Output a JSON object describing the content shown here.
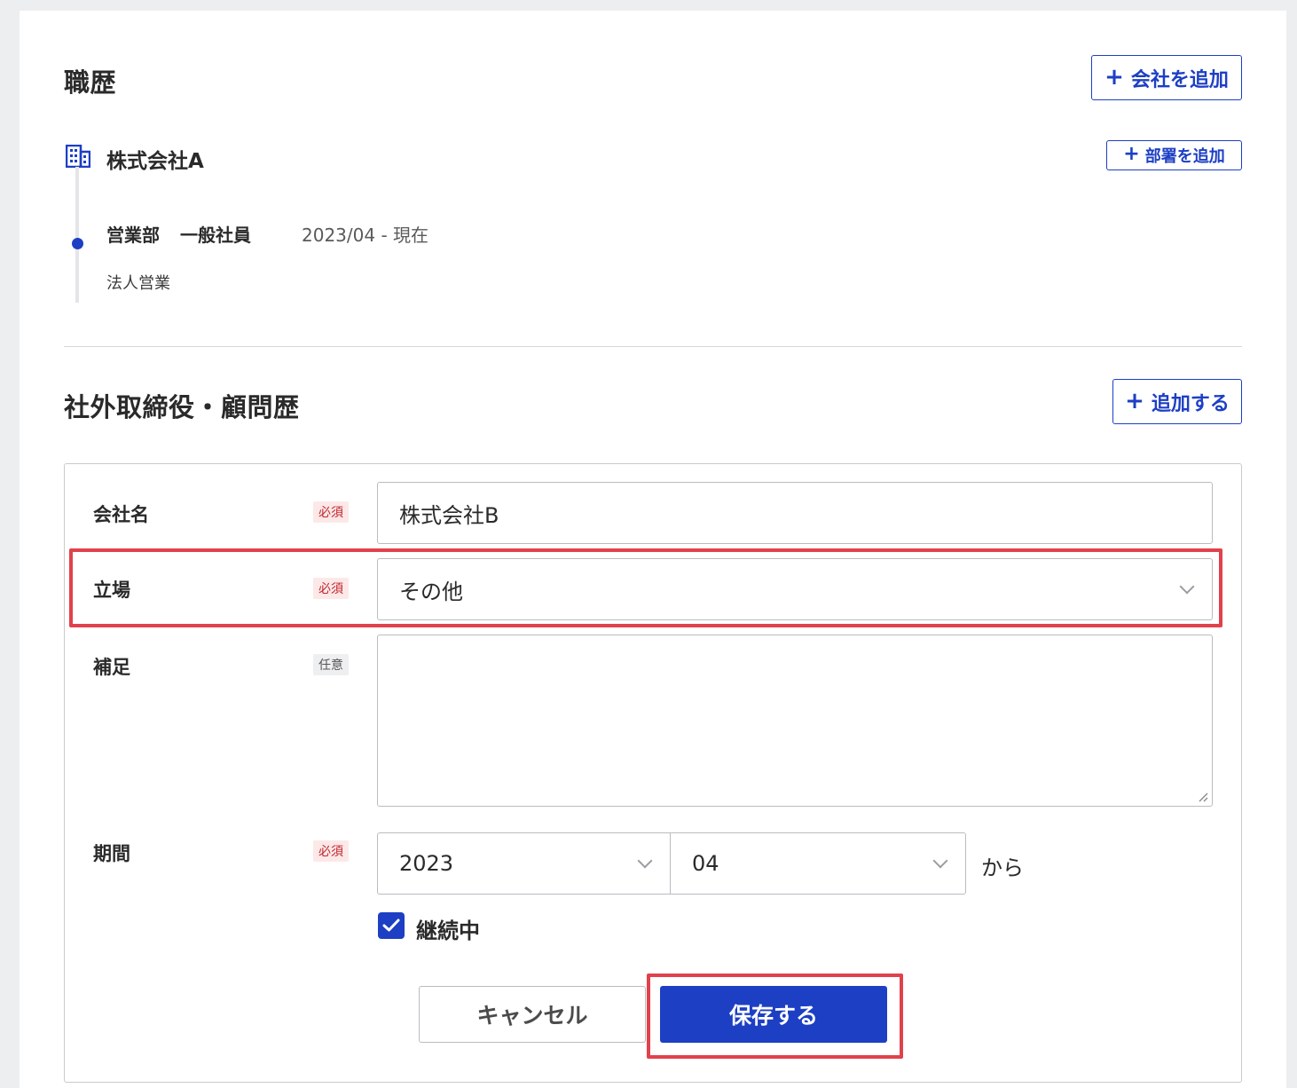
{
  "career": {
    "title": "職歴",
    "add_company_label": "会社を追加",
    "company": {
      "name": "株式会社A",
      "add_department_label": "部署を追加",
      "department": "営業部",
      "position": "一般社員",
      "period": "2023/04 - 現在",
      "description": "法人営業"
    }
  },
  "board": {
    "title": "社外取締役・顧問歴",
    "add_label": "追加する",
    "form": {
      "company_label": "会社名",
      "company_value": "株式会社B",
      "position_label": "立場",
      "position_value": "その他",
      "note_label": "補足",
      "note_value": "",
      "period_label": "期間",
      "year_value": "2023",
      "month_value": "04",
      "from_text": "から",
      "ongoing_label": "継続中",
      "ongoing_checked": true,
      "required_badge": "必須",
      "optional_badge": "任意",
      "cancel_label": "キャンセル",
      "save_label": "保存する"
    }
  },
  "colors": {
    "accent": "#1d3fc4",
    "highlight": "#e1414b",
    "required_bg": "#fde8e8",
    "required_text": "#c0262d"
  },
  "icons": {
    "add": "plus-icon",
    "company": "building-icon",
    "select": "chevron-down-icon",
    "check": "check-icon"
  }
}
